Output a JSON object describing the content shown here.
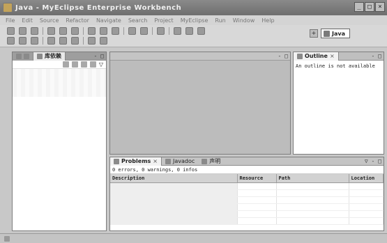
{
  "window": {
    "title": "Java - MyEclipse Enterprise Workbench",
    "controls": {
      "minimize": "_",
      "maximize": "□",
      "close": "×"
    }
  },
  "menu": {
    "items": [
      "File",
      "Edit",
      "Source",
      "Refactor",
      "Navigate",
      "Search",
      "Project",
      "MyEclipse",
      "Run",
      "Window",
      "Help"
    ]
  },
  "perspective": {
    "open_icon": "open-perspective-icon",
    "active": "Java"
  },
  "package_view": {
    "tab_label": "库依赖",
    "controls": "- □",
    "view_controls": "▽"
  },
  "editor": {
    "controls": "- □"
  },
  "outline": {
    "tab_label": "Outline",
    "close_mark": "×",
    "controls": "- □",
    "message": "An outline is not available"
  },
  "problems": {
    "tabs": [
      {
        "label": "Problems",
        "close_mark": "×"
      },
      {
        "label": "Javadoc"
      },
      {
        "label": "声明"
      }
    ],
    "controls": "▽ - □",
    "summary": "0 errors, 0 warnings, 0 infos",
    "columns": [
      "Description",
      "Resource",
      "Path",
      "Location"
    ]
  }
}
